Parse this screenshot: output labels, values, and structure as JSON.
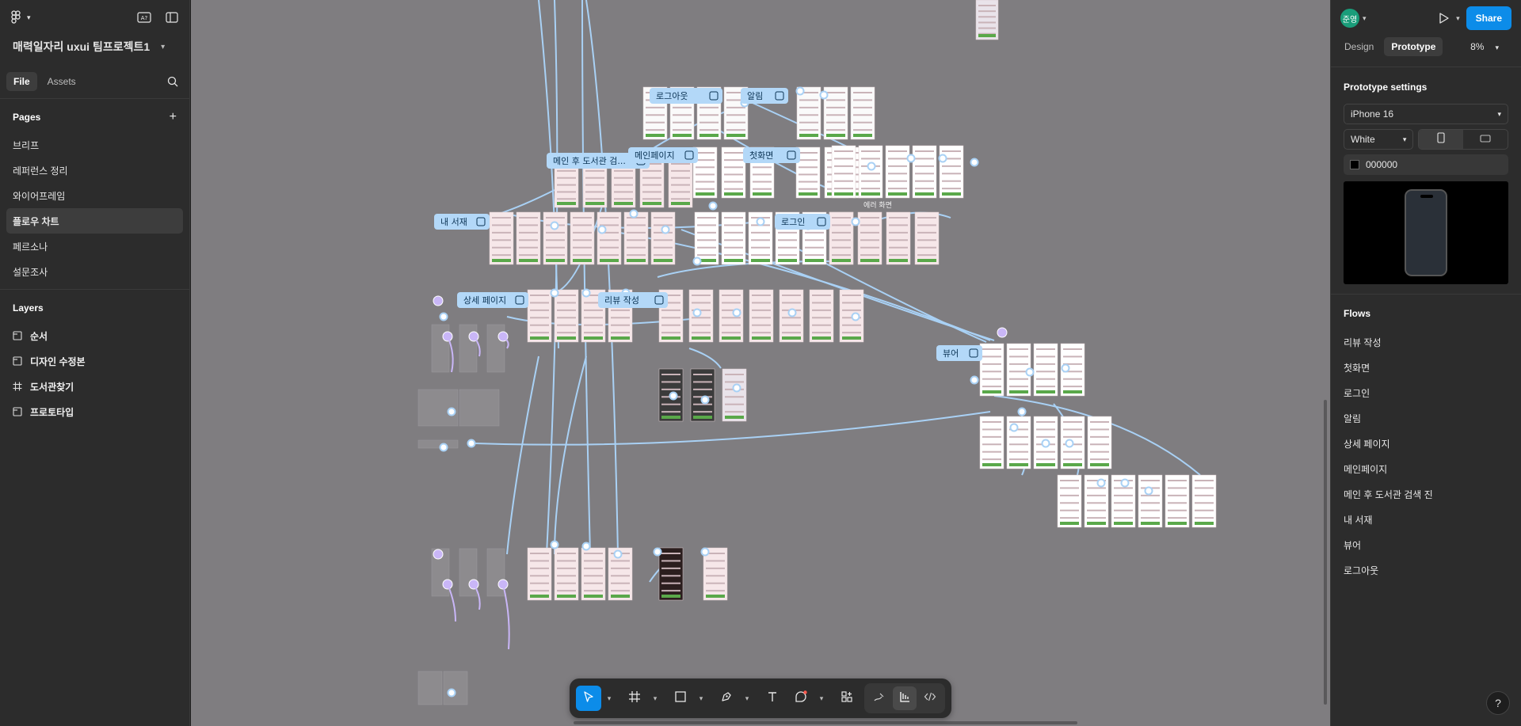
{
  "project": {
    "title": "매력일자리 uxui 팀프로젝트1"
  },
  "left_panel": {
    "tabs": [
      "File",
      "Assets"
    ],
    "pages_title": "Pages",
    "pages": [
      "브리프",
      "레퍼런스 정리",
      "와이어프레임",
      "플로우 차트",
      "페르소나",
      "설문조사"
    ],
    "selected_page": "플로우 차트",
    "layers_title": "Layers",
    "layers": [
      {
        "name": "순서",
        "icon": "section-icon"
      },
      {
        "name": "디자인 수정본",
        "icon": "section-icon"
      },
      {
        "name": "도서관찾기",
        "icon": "frame-icon"
      },
      {
        "name": "프로토타입",
        "icon": "section-icon"
      }
    ]
  },
  "right_panel": {
    "avatar_initials": "준영",
    "share_label": "Share",
    "tabs": [
      "Design",
      "Prototype"
    ],
    "active_tab": "Prototype",
    "zoom": "8%",
    "prototype_settings_title": "Prototype settings",
    "device": "iPhone 16",
    "device_color": "White",
    "background_hex": "000000",
    "flows_title": "Flows",
    "flows": [
      "리뷰 작성",
      "첫화면",
      "로그인",
      "알림",
      "상세 페이지",
      "메인페이지",
      "메인 후 도서관 검색 진",
      "내 서재",
      "뷰어",
      "로그아웃"
    ]
  },
  "canvas": {
    "flow_labels": [
      "로그아웃",
      "알림",
      "메인 후 도서관 검...",
      "메인페이지",
      "첫화면",
      "내 서재",
      "로그인",
      "상세 페이지",
      "리뷰 작성",
      "뷰어"
    ],
    "annotations": [
      "에러 화면"
    ]
  },
  "toolbar": {
    "tools": [
      "move-tool",
      "frame-tool",
      "shape-tool",
      "pen-tool",
      "text-tool",
      "comment-tool",
      "actions-tool"
    ],
    "modes": [
      "draw-mode",
      "design-mode",
      "dev-mode"
    ],
    "active_tool": "move-tool",
    "active_mode": "design-mode"
  },
  "colors": {
    "canvas": "#7f7d80",
    "panel": "#2c2c2c",
    "accent": "#0c8ce9",
    "connector": "#a9d1f5",
    "flow_start": "#c9b6f7"
  }
}
